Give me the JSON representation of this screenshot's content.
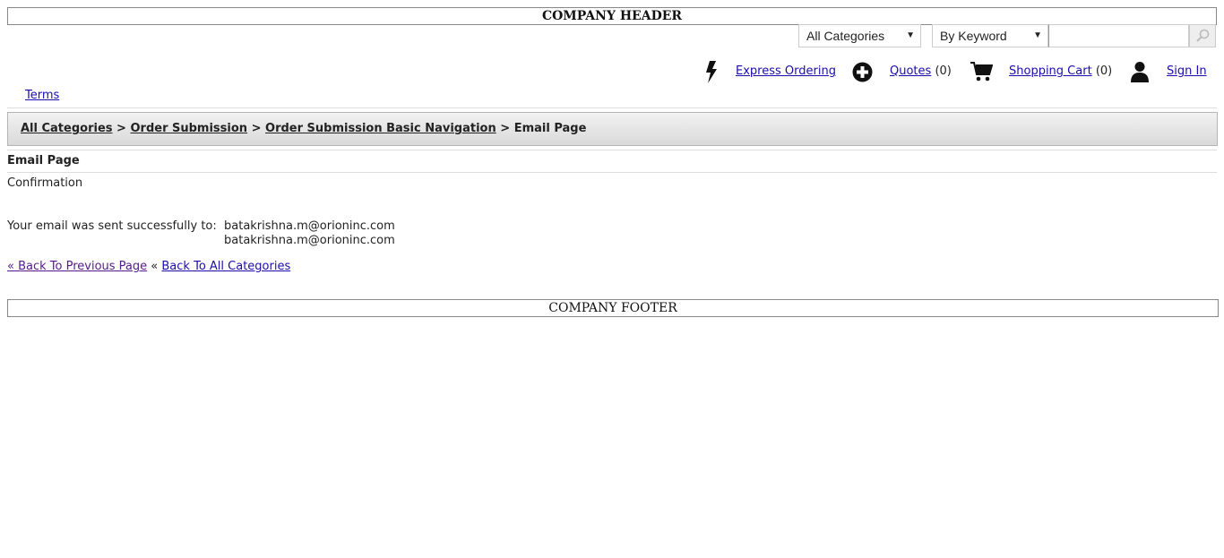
{
  "header": {
    "title": "COMPANY HEADER"
  },
  "search": {
    "category_value": "All Categories",
    "mode_value": "By Keyword",
    "query_value": ""
  },
  "utility_nav": {
    "express_ordering": "Express Ordering",
    "quotes": "Quotes",
    "quotes_count": "(0)",
    "shopping_cart": "Shopping Cart",
    "cart_count": "(0)",
    "sign_in": "Sign In"
  },
  "terms_link": "Terms",
  "breadcrumb": {
    "items": [
      "All Categories",
      "Order Submission",
      "Order Submission Basic Navigation"
    ],
    "separator": ">",
    "current": "Email Page"
  },
  "main": {
    "heading": "Email Page",
    "subheading": "Confirmation",
    "message_label": "Your email was sent successfully to:",
    "emails": [
      "batakrishna.m@orioninc.com",
      "batakrishna.m@orioninc.com"
    ],
    "back_previous": "« Back To Previous Page",
    "back_separator": "«",
    "back_all": "Back To All Categories"
  },
  "footer": {
    "title": "COMPANY FOOTER"
  },
  "icons": {
    "express": "lightning-bolt-icon",
    "quotes": "plus-circle-icon",
    "cart": "shopping-cart-icon",
    "user": "user-icon",
    "search": "magnifier-icon"
  },
  "colors": {
    "link": "#1a0dab",
    "visited_link": "#551a8b",
    "breadcrumb_bg": "#d9d9d9"
  }
}
